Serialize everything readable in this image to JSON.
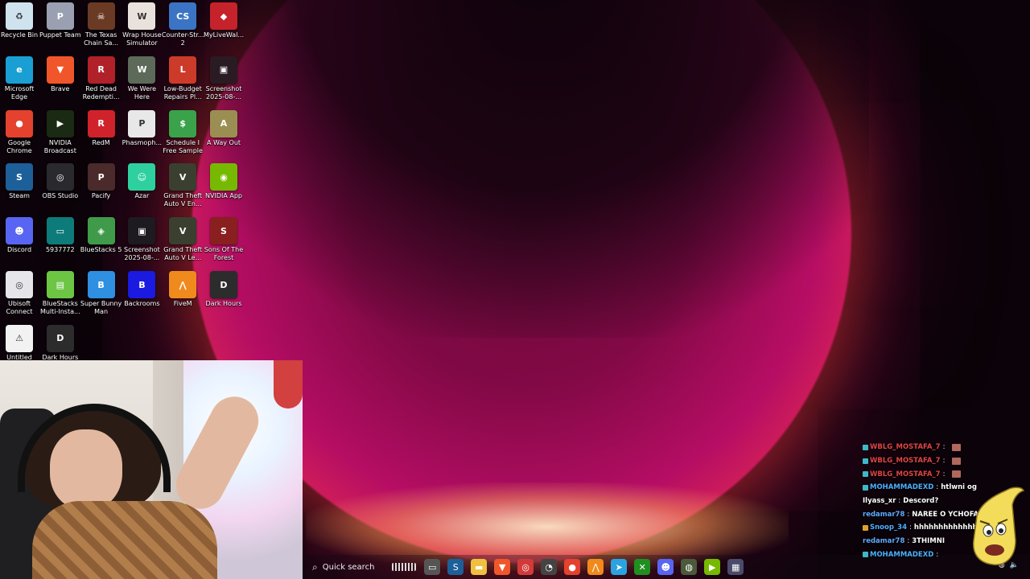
{
  "desktop": {
    "icons": [
      {
        "label": "Recycle Bin",
        "icon": "recycle-bin-icon",
        "color": "#cfe3ef",
        "glyph": "♻"
      },
      {
        "label": "Puppet Team",
        "icon": "puppet-team-icon",
        "color": "#9aa0b2",
        "glyph": "P"
      },
      {
        "label": "The Texas Chain Sa...",
        "icon": "texas-chain-saw-icon",
        "color": "#6b3a25",
        "glyph": "☠"
      },
      {
        "label": "Wrap House Simulator",
        "icon": "wrap-house-icon",
        "color": "#e9e2dc",
        "glyph": "W"
      },
      {
        "label": "Counter-Str... 2",
        "icon": "counter-strike-icon",
        "color": "#3b74c4",
        "glyph": "CS"
      },
      {
        "label": "MyLiveWal...",
        "icon": "mylivewallpaper-icon",
        "color": "#c5222b",
        "glyph": "◆"
      },
      {
        "label": "Microsoft Edge",
        "icon": "edge-icon",
        "color": "#1a9fd4",
        "glyph": "e"
      },
      {
        "label": "Brave",
        "icon": "brave-icon",
        "color": "#f1562b",
        "glyph": "▼"
      },
      {
        "label": "Red Dead Redempti...",
        "icon": "red-dead-icon",
        "color": "#b0212a",
        "glyph": "R"
      },
      {
        "label": "We Were Here",
        "icon": "we-were-here-icon",
        "color": "#5d6a5a",
        "glyph": "W"
      },
      {
        "label": "Low-Budget Repairs Pl...",
        "icon": "low-budget-repairs-icon",
        "color": "#cc3b2a",
        "glyph": "L"
      },
      {
        "label": "Screenshot 2025-08-...",
        "icon": "screenshot-icon",
        "color": "#2a1b22",
        "glyph": "▣"
      },
      {
        "label": "Google Chrome",
        "icon": "chrome-icon",
        "color": "#e4412f",
        "glyph": "●"
      },
      {
        "label": "NVIDIA Broadcast",
        "icon": "nvidia-broadcast-icon",
        "color": "#1b2a12",
        "glyph": "▶"
      },
      {
        "label": "RedM",
        "icon": "redm-icon",
        "color": "#d0222a",
        "glyph": "R"
      },
      {
        "label": "Phasmoph...",
        "icon": "phasmophobia-icon",
        "color": "#e8e8e8",
        "glyph": "P"
      },
      {
        "label": "Schedule I Free Sample",
        "icon": "schedule-one-icon",
        "color": "#3aa24a",
        "glyph": "$"
      },
      {
        "label": "A Way Out",
        "icon": "a-way-out-icon",
        "color": "#9b8e52",
        "glyph": "A"
      },
      {
        "label": "Steam",
        "icon": "steam-icon",
        "color": "#1d5f98",
        "glyph": "S"
      },
      {
        "label": "OBS Studio",
        "icon": "obs-icon",
        "color": "#2a2a2e",
        "glyph": "◎"
      },
      {
        "label": "Pacify",
        "icon": "pacify-icon",
        "color": "#4a2a2a",
        "glyph": "P"
      },
      {
        "label": "Azar",
        "icon": "azar-icon",
        "color": "#2fd0a0",
        "glyph": "☺"
      },
      {
        "label": "Grand Theft Auto V En...",
        "icon": "gta-v-enhanced-icon",
        "color": "#3a3f2f",
        "glyph": "V"
      },
      {
        "label": "NVIDIA App",
        "icon": "nvidia-app-icon",
        "color": "#76b900",
        "glyph": "◉"
      },
      {
        "label": "Discord",
        "icon": "discord-icon",
        "color": "#5865f2",
        "glyph": "☻"
      },
      {
        "label": "5937772",
        "icon": "file-5937772-icon",
        "color": "#0d7b7a",
        "glyph": "▭"
      },
      {
        "label": "BlueStacks 5",
        "icon": "bluestacks-icon",
        "color": "#3f9b4a",
        "glyph": "◈"
      },
      {
        "label": "Screenshot 2025-08-...",
        "icon": "screenshot-icon",
        "color": "#1d1a20",
        "glyph": "▣"
      },
      {
        "label": "Grand Theft Auto V Le...",
        "icon": "gta-v-legacy-icon",
        "color": "#3a3f2f",
        "glyph": "V"
      },
      {
        "label": "Sons Of The Forest",
        "icon": "sons-of-the-forest-icon",
        "color": "#8a1f1f",
        "glyph": "S"
      },
      {
        "label": "Ubisoft Connect",
        "icon": "ubisoft-connect-icon",
        "color": "#e6e6ea",
        "glyph": "◎"
      },
      {
        "label": "BlueStacks Multi-Insta...",
        "icon": "bluestacks-multi-icon",
        "color": "#6dc544",
        "glyph": "▤"
      },
      {
        "label": "Super Bunny Man",
        "icon": "super-bunny-man-icon",
        "color": "#2f8fe0",
        "glyph": "B"
      },
      {
        "label": "Backrooms",
        "icon": "backrooms-icon",
        "color": "#1a1ae0",
        "glyph": "B"
      },
      {
        "label": "FiveM",
        "icon": "fivem-icon",
        "color": "#f08a1c",
        "glyph": "⋀"
      },
      {
        "label": "Dark Hours",
        "icon": "dark-hours-icon",
        "color": "#2c2c2c",
        "glyph": "D"
      },
      {
        "label": "Untitled",
        "icon": "untitled-icon",
        "color": "#f2f2f2",
        "glyph": "⚠"
      },
      {
        "label": "Dark Hours",
        "icon": "dark-hours-icon",
        "color": "#2c2c2c",
        "glyph": "D"
      }
    ]
  },
  "taskbar": {
    "search_placeholder": "Quick search",
    "apps": [
      {
        "icon": "desktop-icon",
        "color": "#555",
        "glyph": "▭"
      },
      {
        "icon": "steam-taskbar-icon",
        "color": "#1d5f98",
        "glyph": "S"
      },
      {
        "icon": "file-explorer-icon",
        "color": "#f0c040",
        "glyph": "▬"
      },
      {
        "icon": "brave-taskbar-icon",
        "color": "#f1562b",
        "glyph": "▼"
      },
      {
        "icon": "lowbudget-taskbar-icon",
        "color": "#d23a3a",
        "glyph": "◎"
      },
      {
        "icon": "clock-app-icon",
        "color": "#444",
        "glyph": "◔"
      },
      {
        "icon": "chrome-taskbar-icon",
        "color": "#e4412f",
        "glyph": "●"
      },
      {
        "icon": "fivem-taskbar-icon",
        "color": "#f08a1c",
        "glyph": "⋀"
      },
      {
        "icon": "telegram-icon",
        "color": "#2aa3e0",
        "glyph": "➤"
      },
      {
        "icon": "xbox-icon",
        "color": "#1f8f1f",
        "glyph": "✕"
      },
      {
        "icon": "discord-taskbar-icon",
        "color": "#5865f2",
        "glyph": "☻"
      },
      {
        "icon": "network-app-icon",
        "color": "#4a5a3a",
        "glyph": "◍"
      },
      {
        "icon": "nvidia-taskbar-icon",
        "color": "#76b900",
        "glyph": "▶"
      },
      {
        "icon": "calculator-icon",
        "color": "#4a4a6a",
        "glyph": "▦"
      }
    ]
  },
  "chat": {
    "messages": [
      {
        "user": "WBLG_MOSTAFA_7",
        "text": "",
        "user_color": "#e04545",
        "emote": true,
        "badge": "#3fb7c9"
      },
      {
        "user": "WBLG_MOSTAFA_7",
        "text": "",
        "user_color": "#e04545",
        "emote": true,
        "badge": "#3fb7c9"
      },
      {
        "user": "WBLG_MOSTAFA_7",
        "text": "",
        "user_color": "#e04545",
        "emote": true,
        "badge": "#3fb7c9"
      },
      {
        "user": "MOHAMMADEXD",
        "text": "htlwni og",
        "user_color": "#4ab0ff",
        "emote": false,
        "badge": "#3fb7c9"
      },
      {
        "user": "Ilyass_xr",
        "text": "Descord?",
        "user_color": "#ffffff",
        "emote": false,
        "badge": ""
      },
      {
        "user": "redamar78",
        "text": "NAREE O YCHOFA 7IDAAN",
        "user_color": "#5fa9ff",
        "emote": false,
        "badge": ""
      },
      {
        "user": "Snoop_34",
        "text": "hhhhhhhhhhhhhh",
        "user_color": "#4ab0ff",
        "emote": false,
        "badge": "#e0a030"
      },
      {
        "user": "redamar78",
        "text": "3THIMNI",
        "user_color": "#5fa9ff",
        "emote": false,
        "badge": ""
      },
      {
        "user": "MOHAMMADEXD",
        "text": "",
        "user_color": "#4ab0ff",
        "emote": false,
        "badge": "#3fb7c9"
      }
    ]
  }
}
